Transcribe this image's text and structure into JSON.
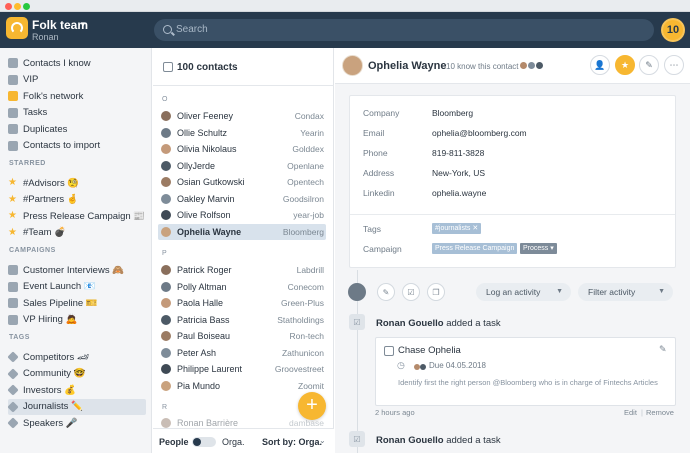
{
  "window": {
    "dot_colors": [
      "#ff5f57",
      "#febc2e",
      "#28c840"
    ]
  },
  "topbar": {
    "team_name": "Folk team",
    "team_user": "Ronan",
    "search_placeholder": "Search",
    "notif_count": "10"
  },
  "sidebar": {
    "top_items": [
      {
        "label": "Contacts I know",
        "icon": "person-icon",
        "color": "#9aa6b2"
      },
      {
        "label": "VIP",
        "icon": "person-icon",
        "color": "#9aa6b2"
      },
      {
        "label": "Folk's network",
        "icon": "network-icon",
        "color": "#f7b731"
      },
      {
        "label": "Tasks",
        "icon": "checkbox-icon",
        "color": "#9aa6b2"
      },
      {
        "label": "Duplicates",
        "icon": "duplicate-icon",
        "color": "#9aa6b2"
      },
      {
        "label": "Contacts to import",
        "icon": "import-icon",
        "color": "#9aa6b2"
      }
    ],
    "starred_title": "STARRED",
    "starred": [
      {
        "label": "#Advisors 🧐"
      },
      {
        "label": "#Partners 🤞"
      },
      {
        "label": "Press Release Campaign 📰"
      },
      {
        "label": "#Team 💣"
      }
    ],
    "campaigns_title": "CAMPAIGNS",
    "campaigns": [
      {
        "label": "Customer Interviews 🙈"
      },
      {
        "label": "Event Launch 📧"
      },
      {
        "label": "Sales Pipeline 🎫"
      },
      {
        "label": "VP Hiring 🙇"
      }
    ],
    "tags_title": "TAGS",
    "tags": [
      {
        "label": "Competitors 🏎"
      },
      {
        "label": "Community 🤓"
      },
      {
        "label": "Investors 💰"
      },
      {
        "label": "Journalists ✏️"
      },
      {
        "label": "Speakers 🎤"
      }
    ]
  },
  "list": {
    "count_label": "100 contacts",
    "group_o": "O",
    "group_p": "P",
    "group_r": "R",
    "rows_o": [
      {
        "name": "Oliver Feeney",
        "company": "Condax"
      },
      {
        "name": "Ollie Schultz",
        "company": "Yearin"
      },
      {
        "name": "Olivia Nikolaus",
        "company": "Golddex"
      },
      {
        "name": "OllyJerde",
        "company": "Openlane"
      },
      {
        "name": "Osian Gutkowski",
        "company": "Opentech"
      },
      {
        "name": "Oakley Marvin",
        "company": "Goodsilron"
      },
      {
        "name": "Olive Rolfson",
        "company": "year-job"
      },
      {
        "name": "Ophelia Wayne",
        "company": "Bloomberg"
      }
    ],
    "rows_p": [
      {
        "name": "Patrick Roger",
        "company": "Labdrill"
      },
      {
        "name": "Polly Altman",
        "company": "Conecom"
      },
      {
        "name": "Paola Halle",
        "company": "Green-Plus"
      },
      {
        "name": "Patricia Bass",
        "company": "Statholdings"
      },
      {
        "name": "Paul Boiseau",
        "company": "Ron-tech"
      },
      {
        "name": "Peter Ash",
        "company": "Zathunicon"
      },
      {
        "name": "Philippe Laurent",
        "company": "Groovestreet"
      },
      {
        "name": "Pia Mundo",
        "company": "Zoomit"
      }
    ],
    "rows_r": [
      {
        "name": "Ronan Barrière",
        "company": "dambase"
      }
    ],
    "fab": "+",
    "footer": {
      "people": "People",
      "orga": "Orga.",
      "sort": "Sort by: Orga."
    }
  },
  "detail": {
    "name": "Ophelia Wayne",
    "know_text": "10 know this contact",
    "fields": [
      {
        "label": "Company",
        "value": "Bloomberg"
      },
      {
        "label": "Email",
        "value": "ophelia@bloomberg.com"
      },
      {
        "label": "Phone",
        "value": "819-811-3828"
      },
      {
        "label": "Address",
        "value": "New-York, US"
      },
      {
        "label": "Linkedin",
        "value": "ophelia.wayne"
      }
    ],
    "tags_label": "Tags",
    "tag_value": "#journalists ✕",
    "campaign_label": "Campaign",
    "campaign_value": "Press Release Campaign",
    "campaign_status": "Process ▾",
    "filter_activity": "Log an activity",
    "filter_filter": "Filter activity",
    "act1_user": "Ronan Gouello",
    "act1_text": "added a task",
    "task_title": "Chase Ophelia",
    "task_due": "Due 04.05.2018",
    "task_desc": "Identify first the right person @Bloomberg who is in charge of Fintechs Articles",
    "task_time": "2 hours ago",
    "task_edit": "Edit",
    "task_remove": "Remove",
    "act2_user": "Ronan Gouello",
    "act2_text": "added a task"
  },
  "colors": {
    "accent": "#f7b731",
    "dark": "#273a4d",
    "tag": "#a7bfd6",
    "status": "#7d8b99"
  }
}
